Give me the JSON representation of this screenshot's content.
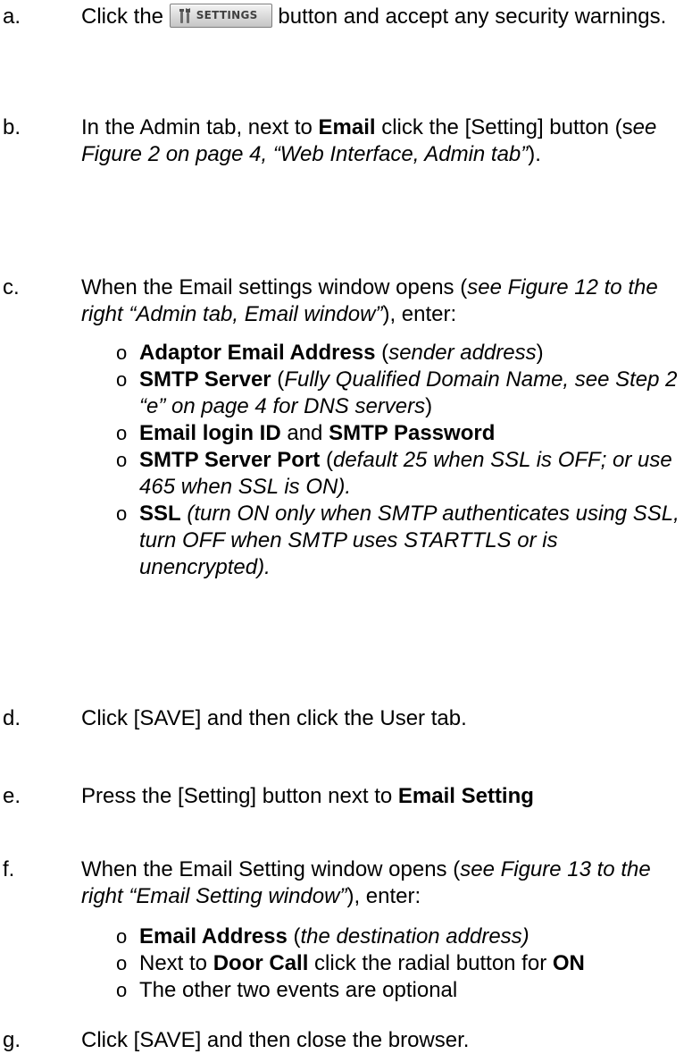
{
  "steps": [
    {
      "letter": "a.",
      "segments": [
        {
          "t": "Click the "
        },
        {
          "button": "settings"
        },
        {
          "t": " button and accept any security warnings."
        }
      ]
    },
    {
      "letter": "b.",
      "segments": [
        {
          "t": "In the Admin tab, next to "
        },
        {
          "t": "Email",
          "b": true
        },
        {
          "t": " click the [Setting] button (s"
        },
        {
          "t": "ee Figure 2 on page 4, “Web Interface, Admin tab”",
          "i": true
        },
        {
          "t": ")."
        }
      ]
    },
    {
      "letter": "c.",
      "segments": [
        {
          "t": "When the Email settings window opens ("
        },
        {
          "t": "see Figure 12 to the right “Admin tab, Email window”",
          "i": true
        },
        {
          "t": "), enter:"
        }
      ],
      "subitems": [
        [
          {
            "t": "Adaptor Email Address",
            "b": true
          },
          {
            "t": " ("
          },
          {
            "t": "sender address",
            "i": true
          },
          {
            "t": ")"
          }
        ],
        [
          {
            "t": "SMTP Server",
            "b": true
          },
          {
            "t": " ("
          },
          {
            "t": "Fully Qualified Domain Name, see Step 2 “e” on page 4 for DNS servers",
            "i": true
          },
          {
            "t": ")"
          }
        ],
        [
          {
            "t": "Email login ID",
            "b": true
          },
          {
            "t": " and "
          },
          {
            "t": "SMTP Password",
            "b": true
          }
        ],
        [
          {
            "t": "SMTP Server Port",
            "b": true
          },
          {
            "t": " ("
          },
          {
            "t": "default 25 when SSL is OFF; or use 465 when SSL is ON).",
            "i": true
          }
        ],
        [
          {
            "t": "SSL",
            "b": true
          },
          {
            "t": " "
          },
          {
            "t": "(turn ON only when SMTP authenticates using SSL, turn OFF when SMTP uses STARTTLS or is unencrypted).",
            "i": true
          }
        ]
      ]
    },
    {
      "letter": "d.",
      "segments": [
        {
          "t": "Click [SAVE] and then click the User tab."
        }
      ]
    },
    {
      "letter": "e.",
      "segments": [
        {
          "t": "Press the [Setting] button next to "
        },
        {
          "t": "Email Setting",
          "b": true
        }
      ]
    },
    {
      "letter": "f.",
      "segments": [
        {
          "t": "When the Email Setting window opens ("
        },
        {
          "t": "see Figure 13 to the right “Email Setting window”",
          "i": true
        },
        {
          "t": "), enter:"
        }
      ],
      "subitems": [
        [
          {
            "t": "Email Address",
            "b": true
          },
          {
            "t": " ("
          },
          {
            "t": "the destination address)",
            "i": true
          }
        ],
        [
          {
            "t": "Next to "
          },
          {
            "t": "Door Call",
            "b": true
          },
          {
            "t": " click the radial button for "
          },
          {
            "t": "ON",
            "b": true
          }
        ],
        [
          {
            "t": "The other two events are optional"
          }
        ]
      ]
    },
    {
      "letter": "g.",
      "segments": [
        {
          "t": "Click [SAVE] and then close the browser."
        }
      ]
    }
  ],
  "settings_button": {
    "label": "SETTINGS",
    "icon": "settings-tools-icon"
  },
  "bullet_glyph": "o"
}
